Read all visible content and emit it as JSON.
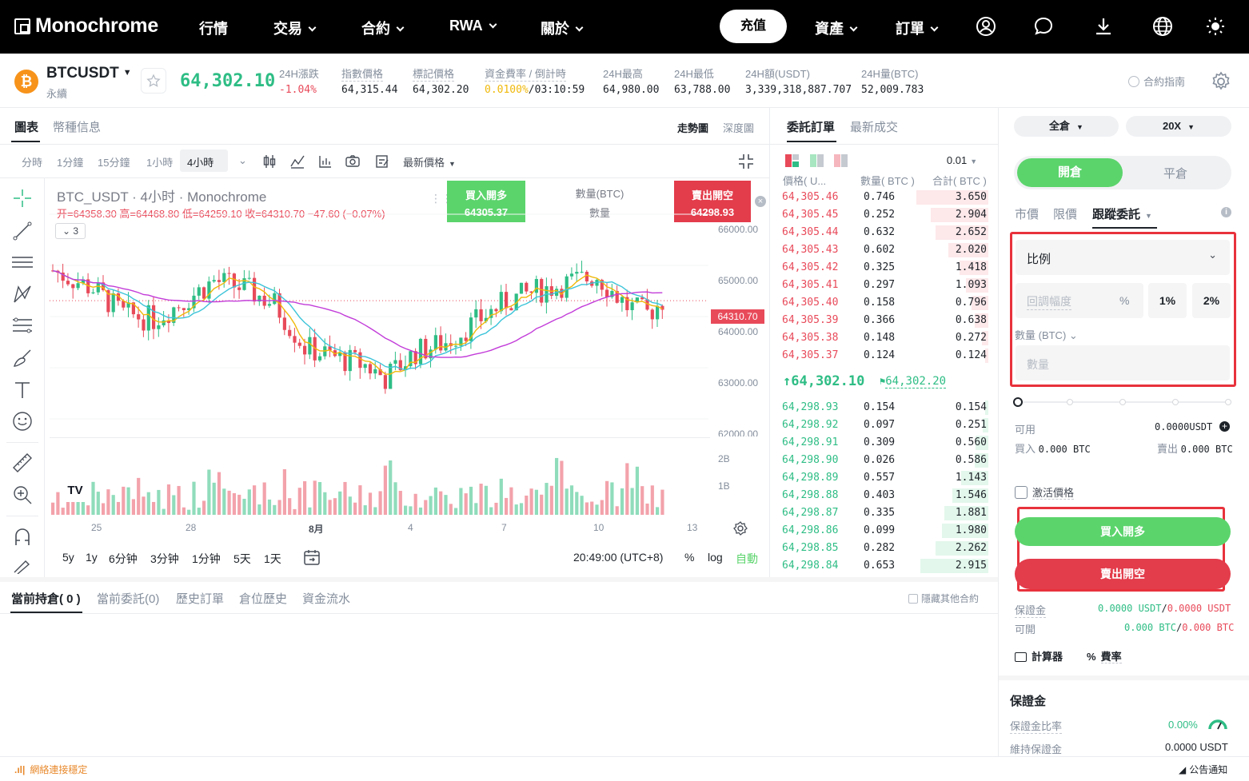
{
  "nav": {
    "logo": "Monochrome",
    "items": [
      {
        "label": "行情",
        "chevron": false
      },
      {
        "label": "交易",
        "chevron": true
      },
      {
        "label": "合約",
        "chevron": true
      },
      {
        "label": "RWA",
        "chevron": true
      },
      {
        "label": "關於",
        "chevron": true
      }
    ],
    "deposit": "充值",
    "assets": "資產",
    "orders": "訂單",
    "icons": [
      "user-icon",
      "chat-icon",
      "download-icon",
      "globe-icon",
      "sun-icon"
    ]
  },
  "ticker": {
    "symbol": "BTCUSDT",
    "subtype": "永續",
    "coin_icon": "₿",
    "last_price": "64,302.10",
    "stats": [
      {
        "label": "24H漲跌",
        "value": "-1.04%",
        "color": "red"
      },
      {
        "label": "指數價格",
        "value": "64,315.44"
      },
      {
        "label": "標記價格",
        "value": "64,302.20"
      },
      {
        "label": "資金費率 / 倒計時",
        "value_a": "0.0100%",
        "value_b": "/03:10:59"
      },
      {
        "label": "24H最高",
        "value": "64,980.00"
      },
      {
        "label": "24H最低",
        "value": "63,788.00"
      },
      {
        "label": "24H額(USDT)",
        "value": "3,339,318,887.707"
      },
      {
        "label": "24H量(BTC)",
        "value": "52,009.783"
      }
    ],
    "guide": "合約指南"
  },
  "chart_panel": {
    "tabs": [
      "圖表",
      "幣種信息"
    ],
    "views": [
      "走勢圖",
      "深度圖"
    ],
    "intervals": [
      "分時",
      "1分鐘",
      "15分鐘",
      "1小時",
      "4小時"
    ],
    "active_interval": "4小時",
    "price_type": "最新價格",
    "title": "BTC_USDT · 4小时 · Monochrome",
    "ohlc": "开=64358.30 高=64468.80 低=64259.10 收=64310.70 −47.60 (−0.07%)",
    "indicator_count": "3",
    "buy_label": "買入開多",
    "buy_price": "64305.37",
    "qty_label": "數量(BTC)",
    "qty_placeholder": "數量",
    "sell_label": "賣出開空",
    "sell_price": "64298.93",
    "current_price_tag": "64310.70",
    "y_ticks": [
      "66000.00",
      "65000.00",
      "64000.00",
      "63000.00",
      "62000.00"
    ],
    "vol_ticks": [
      "2B",
      "1B"
    ],
    "x_ticks": [
      "25",
      "28",
      "8月",
      "4",
      "7",
      "10",
      "13"
    ],
    "ranges": [
      "5y",
      "1y",
      "6分钟",
      "3分钟",
      "1分钟",
      "5天",
      "1天"
    ],
    "time": "20:49:00 (UTC+8)",
    "pct": "%",
    "log": "log",
    "auto": "自動",
    "tv_logo": "TV"
  },
  "orderbook": {
    "tabs": [
      "委託訂單",
      "最新成交"
    ],
    "precision": "0.01",
    "headers": [
      "價格( U...",
      "數量( BTC )",
      "合計( BTC )"
    ],
    "asks": [
      {
        "p": "64,305.46",
        "q": "0.746",
        "t": "3.650",
        "w": 0.9
      },
      {
        "p": "64,305.45",
        "q": "0.252",
        "t": "2.904",
        "w": 0.72
      },
      {
        "p": "64,305.44",
        "q": "0.632",
        "t": "2.652",
        "w": 0.66
      },
      {
        "p": "64,305.43",
        "q": "0.602",
        "t": "2.020",
        "w": 0.5
      },
      {
        "p": "64,305.42",
        "q": "0.325",
        "t": "1.418",
        "w": 0.36
      },
      {
        "p": "64,305.41",
        "q": "0.297",
        "t": "1.093",
        "w": 0.28
      },
      {
        "p": "64,305.40",
        "q": "0.158",
        "t": "0.796",
        "w": 0.21
      },
      {
        "p": "64,305.39",
        "q": "0.366",
        "t": "0.638",
        "w": 0.17
      },
      {
        "p": "64,305.38",
        "q": "0.148",
        "t": "0.272",
        "w": 0.08
      },
      {
        "p": "64,305.37",
        "q": "0.124",
        "t": "0.124",
        "w": 0.04
      }
    ],
    "mid_price": "↑64,302.10",
    "mark_price": "64,302.20",
    "bids": [
      {
        "p": "64,298.93",
        "q": "0.154",
        "t": "0.154",
        "w": 0.04
      },
      {
        "p": "64,298.92",
        "q": "0.097",
        "t": "0.251",
        "w": 0.07
      },
      {
        "p": "64,298.91",
        "q": "0.309",
        "t": "0.560",
        "w": 0.16
      },
      {
        "p": "64,298.90",
        "q": "0.026",
        "t": "0.586",
        "w": 0.17
      },
      {
        "p": "64,298.89",
        "q": "0.557",
        "t": "1.143",
        "w": 0.34
      },
      {
        "p": "64,298.88",
        "q": "0.403",
        "t": "1.546",
        "w": 0.45
      },
      {
        "p": "64,298.87",
        "q": "0.335",
        "t": "1.881",
        "w": 0.55
      },
      {
        "p": "64,298.86",
        "q": "0.099",
        "t": "1.980",
        "w": 0.58
      },
      {
        "p": "64,298.85",
        "q": "0.282",
        "t": "2.262",
        "w": 0.66
      },
      {
        "p": "64,298.84",
        "q": "0.653",
        "t": "2.915",
        "w": 0.85
      }
    ]
  },
  "positions": {
    "tabs": [
      "當前持倉( 0 )",
      "當前委託(0)",
      "歷史訂單",
      "倉位歷史",
      "資金流水"
    ],
    "hide_other": "隱藏其他合約"
  },
  "trade": {
    "margin_mode": "全倉",
    "leverage": "20X",
    "open": "開倉",
    "close": "平倉",
    "order_types": [
      "市價",
      "限價",
      "跟蹤委託"
    ],
    "active_type": "跟蹤委託",
    "ratio_select": "比例",
    "callback_placeholder": "回調幅度",
    "pct_unit": "%",
    "quick": [
      "1%",
      "2%"
    ],
    "qty_label": "數量 (BTC)",
    "qty_placeholder": "數量",
    "available_label": "可用",
    "available_value": "0.0000USDT",
    "buy_label": "買入",
    "buy_value": "0.000 BTC",
    "sell_label": "賣出",
    "sell_value": "0.000 BTC",
    "activate_label": "激活價格",
    "buy_btn": "買入開多",
    "sell_btn": "賣出開空",
    "margin_label": "保證金",
    "margin_value_a": "0.0000 USDT",
    "margin_value_b": "0.0000 USDT",
    "open_label": "可開",
    "open_value_a": "0.000 BTC",
    "open_value_b": "0.000 BTC",
    "calculator": "計算器",
    "fee": "費率"
  },
  "margin_panel": {
    "title": "保證金",
    "ratio_label": "保證金比率",
    "ratio_value": "0.00%",
    "maint_label": "維持保證金",
    "maint_value": "0.0000 USDT"
  },
  "footer": {
    "status": "網絡連接穩定",
    "notice": "公告通知"
  },
  "colors": {
    "green": "#2ebd85",
    "red": "#e84a5a",
    "buy_btn": "#5bd46c",
    "sell_btn": "#e33c4b",
    "accent_yellow": "#f0b90b"
  }
}
